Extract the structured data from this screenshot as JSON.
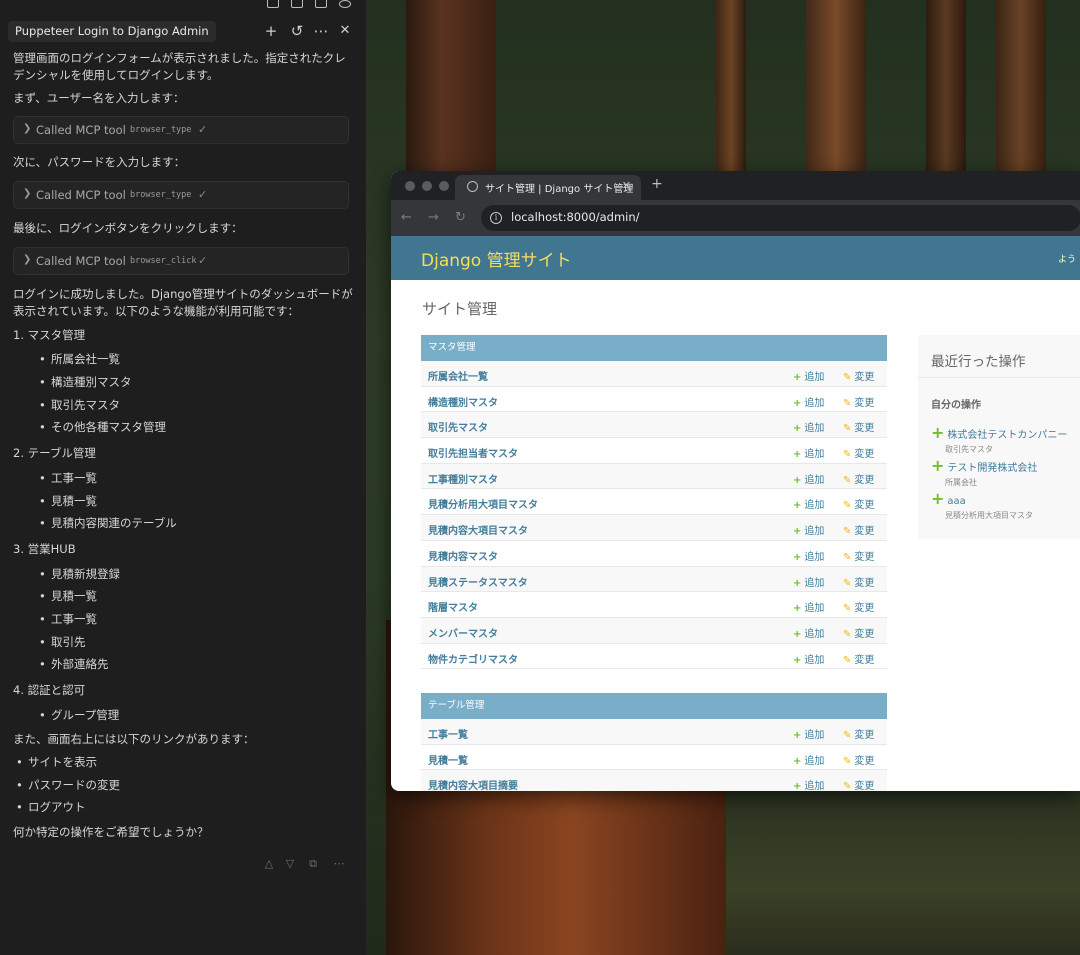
{
  "chat": {
    "tab_title": "Puppeteer Login to Django Admin",
    "paragraph1": "管理画面のログインフォームが表示されました。指定されたクレデンシャルを使用してログインします。",
    "step1": "まず、ユーザー名を入力します：",
    "tool1": {
      "label": "Called MCP tool",
      "code": "browser_type"
    },
    "step2": "次に、パスワードを入力します：",
    "tool2": {
      "label": "Called MCP tool",
      "code": "browser_type"
    },
    "step3": "最後に、ログインボタンをクリックします：",
    "tool3": {
      "label": "Called MCP tool",
      "code": "browser_click"
    },
    "result": "ログインに成功しました。Django管理サイトのダッシュボードが表示されています。以下のような機能が利用可能です：",
    "sections": [
      {
        "heading": "1. マスタ管理",
        "items": [
          "所属会社一覧",
          "構造種別マスタ",
          "取引先マスタ",
          "その他各種マスタ管理"
        ]
      },
      {
        "heading": "2. テーブル管理",
        "items": [
          "工事一覧",
          "見積一覧",
          "見積内容関連のテーブル"
        ]
      },
      {
        "heading": "3. 営業HUB",
        "items": [
          "見積新規登録",
          "見積一覧",
          "工事一覧",
          "取引先",
          "外部連絡先"
        ]
      },
      {
        "heading": "4. 認証と認可",
        "items": [
          "グループ管理"
        ]
      }
    ],
    "links_intro": "また、画面右上には以下のリンクがあります：",
    "links": [
      "サイトを表示",
      "パスワードの変更",
      "ログアウト"
    ],
    "closing": "何か特定の操作をご希望でしょうか？"
  },
  "browser": {
    "tab_title": "サイト管理 | Django サイト管理",
    "url": "localhost:8000/admin/"
  },
  "admin": {
    "brand": "Django 管理サイト",
    "user_tools": "よう",
    "page_title": "サイト管理",
    "add_label": "追加",
    "change_label": "変更",
    "modules": [
      {
        "caption": "マスタ管理",
        "rows": [
          "所属会社一覧",
          "構造種別マスタ",
          "取引先マスタ",
          "取引先担当者マスタ",
          "工事種別マスタ",
          "見積分析用大項目マスタ",
          "見積内容大項目マスタ",
          "見積内容マスタ",
          "見積ステータスマスタ",
          "階層マスタ",
          "メンバーマスタ",
          "物件カテゴリマスタ"
        ]
      },
      {
        "caption": "テーブル管理",
        "rows": [
          "工事一覧",
          "見積一覧",
          "見積内容大項目摘要"
        ]
      }
    ],
    "recent": {
      "title": "最近行った操作",
      "mine": "自分の操作",
      "entries": [
        {
          "name": "株式会社テストカンパニー",
          "type": "取引先マスタ"
        },
        {
          "name": "テスト開発株式会社",
          "type": "所属会社"
        },
        {
          "name": "aaa",
          "type": "見積分析用大項目マスタ"
        }
      ]
    }
  },
  "colors": {
    "django_header": "#417690",
    "django_brand": "#f5dd5d",
    "module_caption": "#79aec8",
    "link": "#447e9b"
  },
  "icons": [
    "plus-icon",
    "history-icon",
    "more-icon",
    "close-icon",
    "chevron-right-icon",
    "check-icon",
    "globe-icon",
    "info-icon",
    "add-icon",
    "pencil-icon",
    "thumbs-up-icon",
    "thumbs-down-icon",
    "copy-icon"
  ]
}
